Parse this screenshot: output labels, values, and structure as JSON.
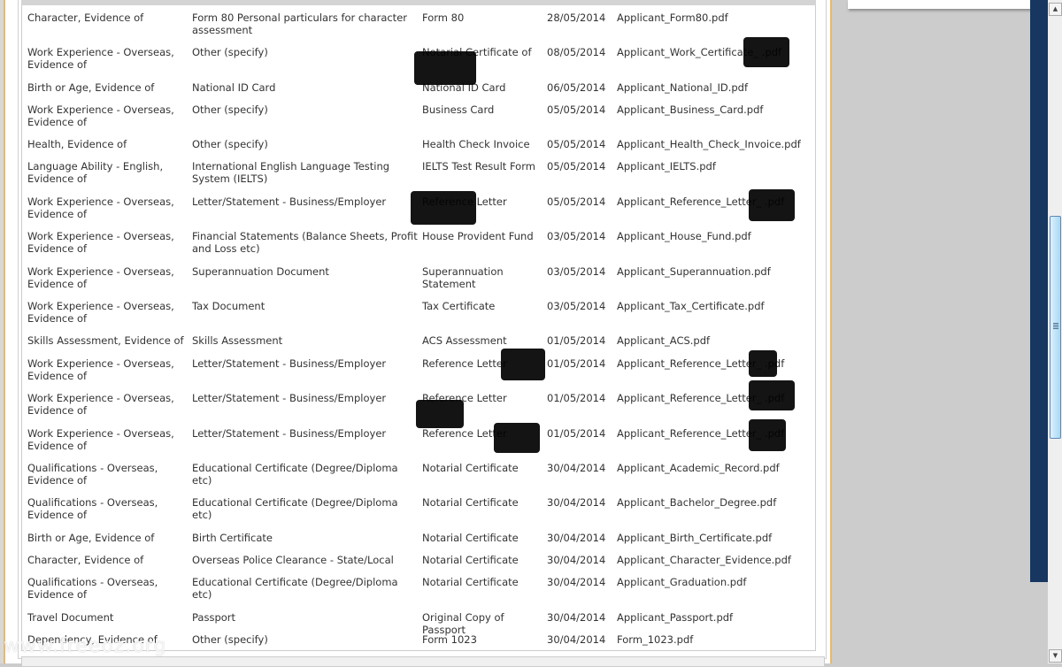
{
  "rows": [
    [
      "Character, Evidence of",
      "Form 80 Personal particulars for character assessment",
      "Form 80",
      "28/05/2014",
      "Applicant_Form80.pdf"
    ],
    [
      "Work Experience - Overseas, Evidence of",
      "Other (specify)",
      "Notarial Certificate of",
      "08/05/2014",
      "Applicant_Work_Certificate_        .pdf"
    ],
    [
      "Birth or Age, Evidence of",
      "National ID Card",
      "National ID Card",
      "06/05/2014",
      "Applicant_National_ID.pdf"
    ],
    [
      "Work Experience - Overseas, Evidence of",
      "Other (specify)",
      "Business Card",
      "05/05/2014",
      "Applicant_Business_Card.pdf"
    ],
    [
      "Health, Evidence of",
      "Other (specify)",
      "Health Check Invoice",
      "05/05/2014",
      "Applicant_Health_Check_Invoice.pdf"
    ],
    [
      "Language Ability - English, Evidence of",
      "International English Language Testing System (IELTS)",
      "IELTS Test Result Form",
      "05/05/2014",
      "Applicant_IELTS.pdf"
    ],
    [
      "Work Experience - Overseas, Evidence of",
      "Letter/Statement - Business/Employer",
      "Reference Letter",
      "05/05/2014",
      "Applicant_Reference_Letter_        .pdf"
    ],
    [
      "Work Experience - Overseas, Evidence of",
      "Financial Statements (Balance Sheets, Profit and Loss etc)",
      "House Provident Fund",
      "03/05/2014",
      "Applicant_House_Fund.pdf"
    ],
    [
      "Work Experience - Overseas, Evidence of",
      "Superannuation Document",
      "Superannuation Statement",
      "03/05/2014",
      "Applicant_Superannuation.pdf"
    ],
    [
      "Work Experience - Overseas, Evidence of",
      "Tax Document",
      "Tax Certificate",
      "03/05/2014",
      "Applicant_Tax_Certificate.pdf"
    ],
    [
      "Skills Assessment, Evidence of",
      "Skills Assessment",
      "ACS Assessment",
      "01/05/2014",
      "Applicant_ACS.pdf"
    ],
    [
      "Work Experience - Overseas, Evidence of",
      "Letter/Statement - Business/Employer",
      "Reference Letter",
      "01/05/2014",
      "Applicant_Reference_Letter_      .pdf"
    ],
    [
      "Work Experience - Overseas, Evidence of",
      "Letter/Statement - Business/Employer",
      "Reference Letter",
      "01/05/2014",
      "Applicant_Reference_Letter_        .pdf"
    ],
    [
      "Work Experience - Overseas, Evidence of",
      "Letter/Statement - Business/Employer",
      "Reference Letter",
      "01/05/2014",
      "Applicant_Reference_Letter_        .pdf"
    ],
    [
      "Qualifications - Overseas, Evidence of",
      "Educational Certificate (Degree/Diploma etc)",
      "Notarial Certificate",
      "30/04/2014",
      "Applicant_Academic_Record.pdf"
    ],
    [
      "Qualifications - Overseas, Evidence of",
      "Educational Certificate (Degree/Diploma etc)",
      "Notarial Certificate",
      "30/04/2014",
      "Applicant_Bachelor_Degree.pdf"
    ],
    [
      "Birth or Age, Evidence of",
      "Birth Certificate",
      "Notarial Certificate",
      "30/04/2014",
      "Applicant_Birth_Certificate.pdf"
    ],
    [
      "Character, Evidence of",
      "Overseas Police Clearance - State/Local",
      "Notarial Certificate",
      "30/04/2014",
      "Applicant_Character_Evidence.pdf"
    ],
    [
      "Qualifications - Overseas, Evidence of",
      "Educational Certificate (Degree/Diploma etc)",
      "Notarial Certificate",
      "30/04/2014",
      "Applicant_Graduation.pdf"
    ],
    [
      "Travel Document",
      "Passport",
      "Original Copy of Passport",
      "30/04/2014",
      "Applicant_Passport.pdf"
    ],
    [
      "Dependency, Evidence of",
      "Other (specify)",
      "Form 1023",
      "30/04/2014",
      "Form_1023.pdf"
    ]
  ],
  "watermark": "www.freeoz.org",
  "scrollbar": {
    "position_percent": 33,
    "visible_percent": 34
  }
}
